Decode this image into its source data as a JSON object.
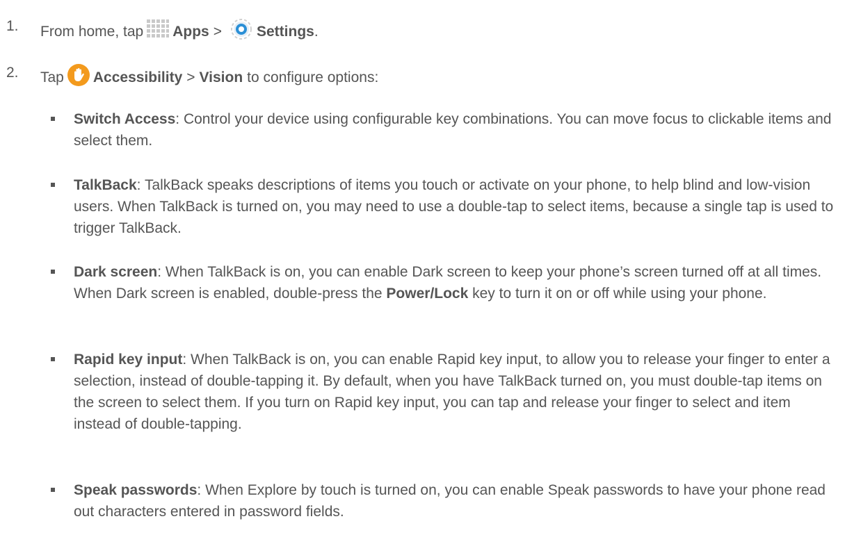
{
  "steps": [
    {
      "number": "1.",
      "prefix": "From home, tap",
      "icon1": "apps-grid-icon",
      "apps_label": "Apps",
      "separator": ">",
      "icon2": "settings-gear-icon",
      "settings_label": "Settings",
      "suffix": "."
    },
    {
      "number": "2.",
      "prefix": "Tap",
      "icon": "accessibility-hand-icon",
      "accessibility_label": "Accessibility",
      "separator": ">",
      "vision_label": "Vision",
      "suffix": "to configure options:"
    }
  ],
  "bullets": [
    {
      "term": "Switch Access",
      "text": ": Control your device using configurable key combinations. You can move focus to clickable items and select them."
    },
    {
      "term": "TalkBack",
      "text": ": TalkBack speaks descriptions of items you touch or activate on your phone, to help blind and low-vision users. When TalkBack is turned on, you may need to use a double-tap to select items, because a single tap is used to trigger TalkBack."
    },
    {
      "term": "Dark screen",
      "text_before": ": When TalkBack is on, you can enable Dark screen to keep your phone’s screen turned off at all times. When Dark screen is enabled, double-press the ",
      "bold_key": "Power/Lock",
      "text_after": " key to turn it on or off while using your phone."
    },
    {
      "term": "Rapid key input",
      "text": ": When TalkBack is on, you can enable Rapid key input, to allow you to release your finger to enter a selection, instead of double-tapping it. By default, when you have TalkBack turned on, you must double-tap items on the screen to select them. If you turn on Rapid key input, you can tap and release your finger to select and item instead of double-tapping."
    },
    {
      "term": "Speak passwords",
      "text": ": When Explore by touch is turned on, you can enable Speak passwords to have your phone read out characters entered in password fields."
    }
  ],
  "colors": {
    "text": "#555555",
    "settings_icon_blue": "#2a8fd6",
    "accessibility_icon_orange": "#f39a1d"
  }
}
